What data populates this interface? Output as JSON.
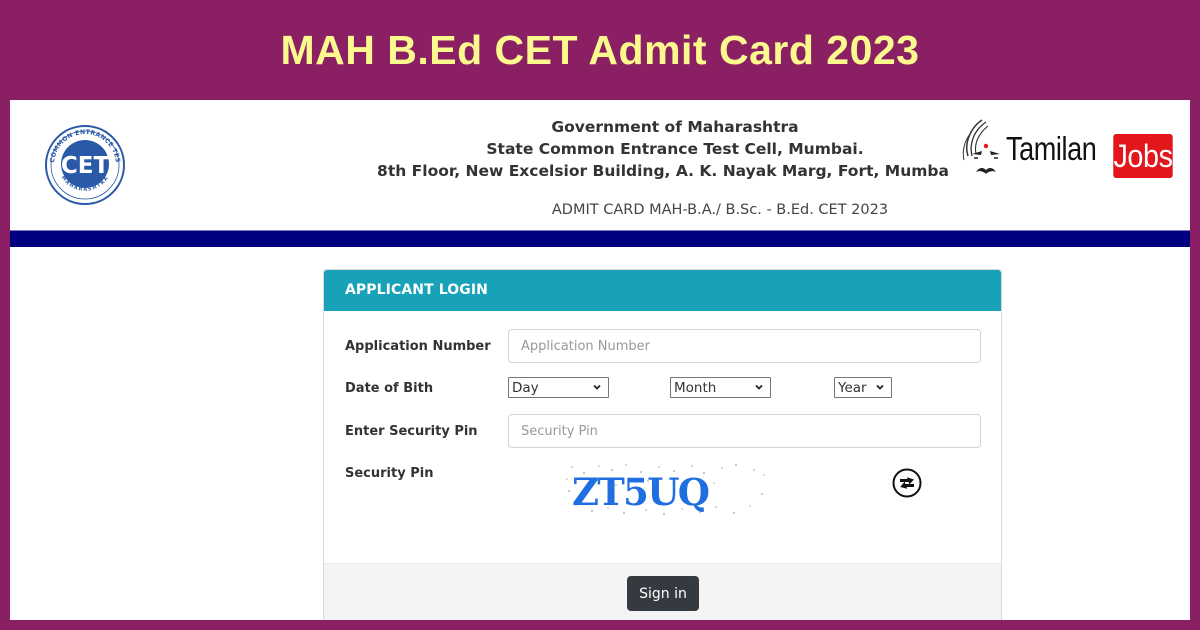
{
  "banner": {
    "title": "MAH B.Ed CET Admit Card 2023",
    "background_color": "#8a2063",
    "title_color": "#fbf98e"
  },
  "header": {
    "cet_logo": {
      "center_text": "CET",
      "ring_text_top": "STATE COMMON ENTRANCE TEST CELL",
      "ring_text_bottom": "MAHARASHTRA"
    },
    "gov_line1": "Government of Maharashtra",
    "gov_line2": "State Common Entrance Test Cell, Mumbai.",
    "gov_line3": "8th Floor, New Excelsior Building, A. K. Nayak Marg, Fort, Mumba",
    "subtitle": "ADMIT CARD MAH-B.A./ B.Sc. - B.Ed. CET 2023",
    "watermark_logo": {
      "word1": "Tamilan",
      "word2": "Jobs",
      "accent_color": "#e3161c"
    },
    "bar_color": "#000080"
  },
  "login": {
    "heading": "APPLICANT LOGIN",
    "heading_color": "#17a2b8",
    "application_number": {
      "label": "Application Number",
      "placeholder": "Application Number",
      "value": ""
    },
    "dob": {
      "label": "Date of Bith",
      "day": "Day",
      "month": "Month",
      "year": "Year"
    },
    "security_pin_input": {
      "label": "Enter Security Pin",
      "placeholder": "Security Pin",
      "value": ""
    },
    "captcha": {
      "label": "Security Pin",
      "text": "ZT5UQ",
      "color": "#1f6fe0"
    },
    "refresh_icon": "refresh-icon",
    "sign_in_label": "Sign in"
  }
}
